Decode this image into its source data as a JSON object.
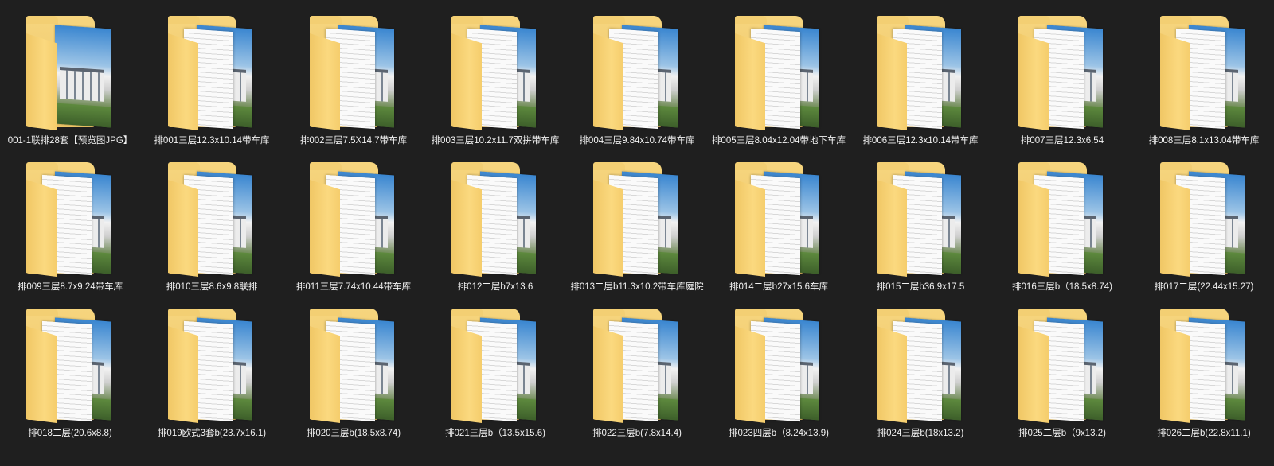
{
  "folders": [
    {
      "label": "001-1联排28套【预览图JPG】"
    },
    {
      "label": "排001三层12.3x10.14带车库"
    },
    {
      "label": "排002三层7.5X14.7带车库"
    },
    {
      "label": "排003三层10.2x11.7双拼带车库"
    },
    {
      "label": "排004三层9.84x10.74带车库"
    },
    {
      "label": "排005三层8.04x12.04带地下车库"
    },
    {
      "label": "排006三层12.3x10.14带车库"
    },
    {
      "label": "排007三层12.3x6.54"
    },
    {
      "label": "排008三层8.1x13.04带车库"
    },
    {
      "label": "排009三层8.7x9.24带车库"
    },
    {
      "label": "排010三层8.6x9.8联排"
    },
    {
      "label": "排011三层7.74x10.44带车库"
    },
    {
      "label": "排012二层b7x13.6"
    },
    {
      "label": "排013二层b11.3x10.2带车库庭院"
    },
    {
      "label": "排014二层b27x15.6车库"
    },
    {
      "label": "排015二层b36.9x17.5"
    },
    {
      "label": "排016三层b（18.5x8.74)"
    },
    {
      "label": "排017二层(22.44x15.27)"
    },
    {
      "label": "排018二层(20.6x8.8)"
    },
    {
      "label": "排019欧式3套b(23.7x16.1)"
    },
    {
      "label": "排020三层b(18.5x8.74)"
    },
    {
      "label": "排021三层b（13.5x15.6)"
    },
    {
      "label": "排022三层b(7.8x14.4)"
    },
    {
      "label": "排023四层b（8.24x13.9)"
    },
    {
      "label": "排024三层b(18x13.2)"
    },
    {
      "label": "排025二层b（9x13.2)"
    },
    {
      "label": "排026二层b(22.8x11.1)"
    }
  ],
  "icon": "folder-icon",
  "colors": {
    "background": "#1f1f1f",
    "folder": "#f6d57e",
    "label_text": "#f2f2f2"
  }
}
